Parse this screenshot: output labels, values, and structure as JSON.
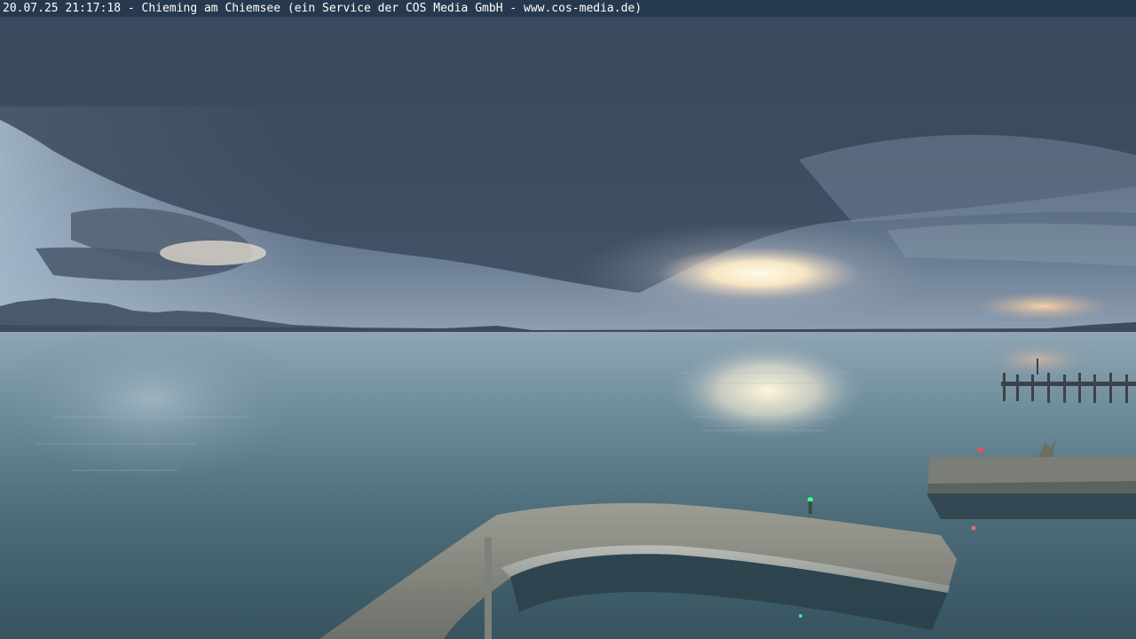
{
  "webcam": {
    "caption": "20.07.25 21:17:18 - Chieming am Chiemsee (ein Service der COS Media GmbH - www.cos-media.de)"
  },
  "colors": {
    "caption_bar": "#27394e",
    "caption_text": "#ffffff",
    "sky_dark": "#3f4f63",
    "sky_light": "#a9b9cc",
    "sun_glow": "#fff3d6",
    "water": "#5f7e8c",
    "water_dark": "#2f4a56",
    "pier_stone": "#8d8f86"
  }
}
